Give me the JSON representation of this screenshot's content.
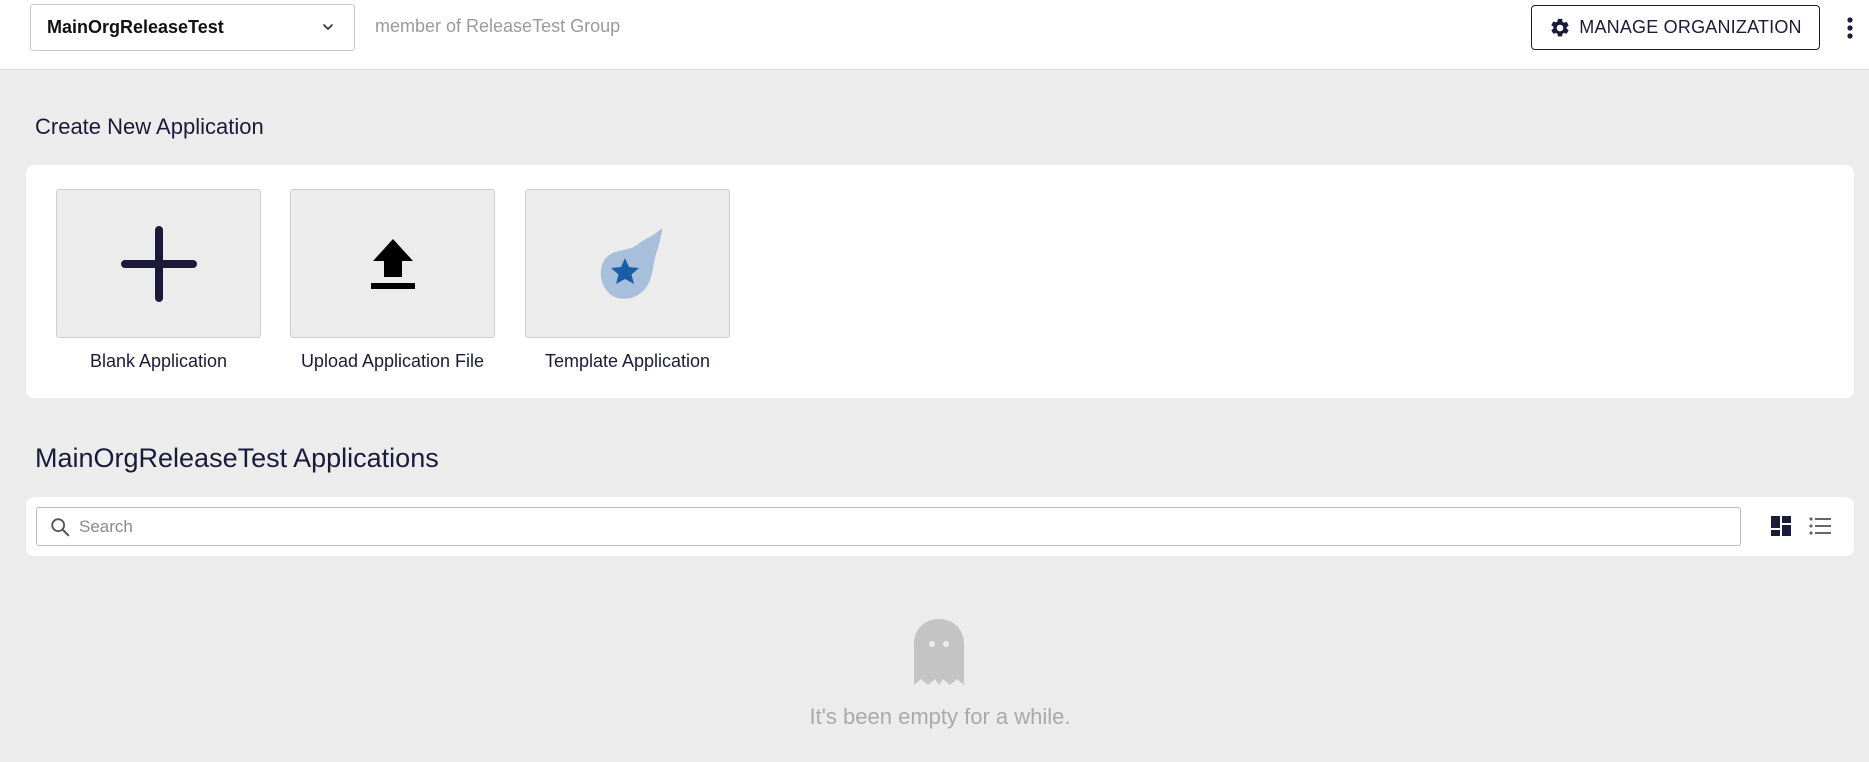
{
  "header": {
    "org_name": "MainOrgReleaseTest",
    "member_text": "member of ReleaseTest Group",
    "manage_label": "MANAGE ORGANIZATION"
  },
  "create": {
    "title": "Create New Application",
    "tiles": [
      {
        "label": "Blank Application",
        "icon": "plus-icon"
      },
      {
        "label": "Upload Application File",
        "icon": "upload-icon"
      },
      {
        "label": "Template Application",
        "icon": "template-comet-star-icon"
      }
    ]
  },
  "apps": {
    "title": "MainOrgReleaseTest Applications",
    "search_placeholder": "Search",
    "empty_text": "It's been empty for a while."
  },
  "colors": {
    "page_bg": "#ececec",
    "panel_bg": "#ffffff",
    "text_primary": "#1b1a3a",
    "muted_text": "#9a9a9a",
    "template_star": "#1a5ea8",
    "template_comet": "#a7bfda",
    "ghost": "#c4c4c4"
  }
}
